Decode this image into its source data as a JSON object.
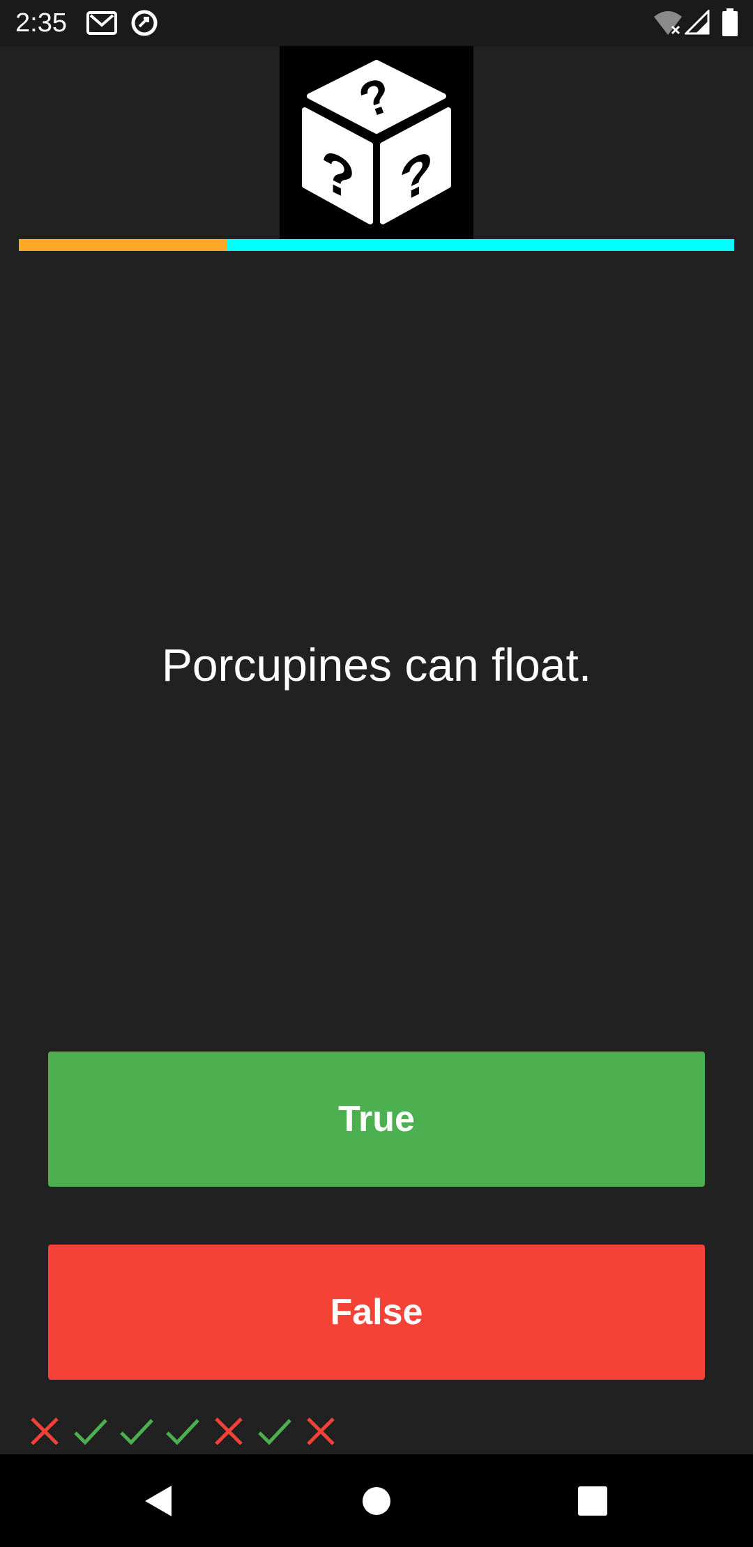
{
  "status_bar": {
    "time": "2:35",
    "icons": [
      "gmail-icon",
      "sync-icon",
      "wifi-off-icon",
      "signal-icon",
      "battery-icon"
    ]
  },
  "app": {
    "logo_icon": "question-dice-icon",
    "progress": {
      "fraction": 0.29,
      "fill_color": "#FFA726",
      "track_color": "#00FFFF"
    },
    "question": "Porcupines can float.",
    "buttons": {
      "true_label": "True",
      "false_label": "False",
      "true_color": "#4CAF50",
      "false_color": "#F44336"
    },
    "score_history": [
      "wrong",
      "correct",
      "correct",
      "correct",
      "wrong",
      "correct",
      "wrong"
    ]
  },
  "nav_bar": {
    "icons": [
      "back-icon",
      "home-icon",
      "recents-icon"
    ]
  }
}
